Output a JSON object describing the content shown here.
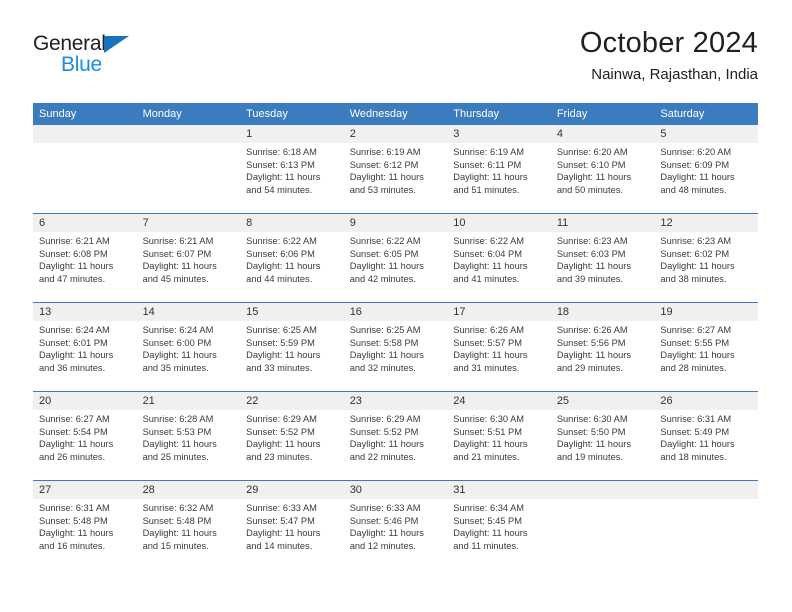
{
  "brand": {
    "name_top": "General",
    "name_bottom": "Blue",
    "accent_dark": "#1a72b8",
    "accent_light": "#1a8ede"
  },
  "header": {
    "title": "October 2024",
    "subtitle": "Nainwa, Rajasthan, India"
  },
  "theme": {
    "header_blue": "#3a7cbe",
    "number_band": "#f0f0f0",
    "text": "#3b3b3b"
  },
  "weekdays": [
    "Sunday",
    "Monday",
    "Tuesday",
    "Wednesday",
    "Thursday",
    "Friday",
    "Saturday"
  ],
  "labels": {
    "sunrise_prefix": "Sunrise:",
    "sunset_prefix": "Sunset:",
    "daylight_prefix": "Daylight:"
  },
  "weeks": [
    [
      {
        "day": "",
        "sunrise": "",
        "sunset": "",
        "daylight_line1": "",
        "daylight_line2": ""
      },
      {
        "day": "",
        "sunrise": "",
        "sunset": "",
        "daylight_line1": "",
        "daylight_line2": ""
      },
      {
        "day": "1",
        "sunrise": "Sunrise: 6:18 AM",
        "sunset": "Sunset: 6:13 PM",
        "daylight_line1": "Daylight: 11 hours",
        "daylight_line2": "and 54 minutes."
      },
      {
        "day": "2",
        "sunrise": "Sunrise: 6:19 AM",
        "sunset": "Sunset: 6:12 PM",
        "daylight_line1": "Daylight: 11 hours",
        "daylight_line2": "and 53 minutes."
      },
      {
        "day": "3",
        "sunrise": "Sunrise: 6:19 AM",
        "sunset": "Sunset: 6:11 PM",
        "daylight_line1": "Daylight: 11 hours",
        "daylight_line2": "and 51 minutes."
      },
      {
        "day": "4",
        "sunrise": "Sunrise: 6:20 AM",
        "sunset": "Sunset: 6:10 PM",
        "daylight_line1": "Daylight: 11 hours",
        "daylight_line2": "and 50 minutes."
      },
      {
        "day": "5",
        "sunrise": "Sunrise: 6:20 AM",
        "sunset": "Sunset: 6:09 PM",
        "daylight_line1": "Daylight: 11 hours",
        "daylight_line2": "and 48 minutes."
      }
    ],
    [
      {
        "day": "6",
        "sunrise": "Sunrise: 6:21 AM",
        "sunset": "Sunset: 6:08 PM",
        "daylight_line1": "Daylight: 11 hours",
        "daylight_line2": "and 47 minutes."
      },
      {
        "day": "7",
        "sunrise": "Sunrise: 6:21 AM",
        "sunset": "Sunset: 6:07 PM",
        "daylight_line1": "Daylight: 11 hours",
        "daylight_line2": "and 45 minutes."
      },
      {
        "day": "8",
        "sunrise": "Sunrise: 6:22 AM",
        "sunset": "Sunset: 6:06 PM",
        "daylight_line1": "Daylight: 11 hours",
        "daylight_line2": "and 44 minutes."
      },
      {
        "day": "9",
        "sunrise": "Sunrise: 6:22 AM",
        "sunset": "Sunset: 6:05 PM",
        "daylight_line1": "Daylight: 11 hours",
        "daylight_line2": "and 42 minutes."
      },
      {
        "day": "10",
        "sunrise": "Sunrise: 6:22 AM",
        "sunset": "Sunset: 6:04 PM",
        "daylight_line1": "Daylight: 11 hours",
        "daylight_line2": "and 41 minutes."
      },
      {
        "day": "11",
        "sunrise": "Sunrise: 6:23 AM",
        "sunset": "Sunset: 6:03 PM",
        "daylight_line1": "Daylight: 11 hours",
        "daylight_line2": "and 39 minutes."
      },
      {
        "day": "12",
        "sunrise": "Sunrise: 6:23 AM",
        "sunset": "Sunset: 6:02 PM",
        "daylight_line1": "Daylight: 11 hours",
        "daylight_line2": "and 38 minutes."
      }
    ],
    [
      {
        "day": "13",
        "sunrise": "Sunrise: 6:24 AM",
        "sunset": "Sunset: 6:01 PM",
        "daylight_line1": "Daylight: 11 hours",
        "daylight_line2": "and 36 minutes."
      },
      {
        "day": "14",
        "sunrise": "Sunrise: 6:24 AM",
        "sunset": "Sunset: 6:00 PM",
        "daylight_line1": "Daylight: 11 hours",
        "daylight_line2": "and 35 minutes."
      },
      {
        "day": "15",
        "sunrise": "Sunrise: 6:25 AM",
        "sunset": "Sunset: 5:59 PM",
        "daylight_line1": "Daylight: 11 hours",
        "daylight_line2": "and 33 minutes."
      },
      {
        "day": "16",
        "sunrise": "Sunrise: 6:25 AM",
        "sunset": "Sunset: 5:58 PM",
        "daylight_line1": "Daylight: 11 hours",
        "daylight_line2": "and 32 minutes."
      },
      {
        "day": "17",
        "sunrise": "Sunrise: 6:26 AM",
        "sunset": "Sunset: 5:57 PM",
        "daylight_line1": "Daylight: 11 hours",
        "daylight_line2": "and 31 minutes."
      },
      {
        "day": "18",
        "sunrise": "Sunrise: 6:26 AM",
        "sunset": "Sunset: 5:56 PM",
        "daylight_line1": "Daylight: 11 hours",
        "daylight_line2": "and 29 minutes."
      },
      {
        "day": "19",
        "sunrise": "Sunrise: 6:27 AM",
        "sunset": "Sunset: 5:55 PM",
        "daylight_line1": "Daylight: 11 hours",
        "daylight_line2": "and 28 minutes."
      }
    ],
    [
      {
        "day": "20",
        "sunrise": "Sunrise: 6:27 AM",
        "sunset": "Sunset: 5:54 PM",
        "daylight_line1": "Daylight: 11 hours",
        "daylight_line2": "and 26 minutes."
      },
      {
        "day": "21",
        "sunrise": "Sunrise: 6:28 AM",
        "sunset": "Sunset: 5:53 PM",
        "daylight_line1": "Daylight: 11 hours",
        "daylight_line2": "and 25 minutes."
      },
      {
        "day": "22",
        "sunrise": "Sunrise: 6:29 AM",
        "sunset": "Sunset: 5:52 PM",
        "daylight_line1": "Daylight: 11 hours",
        "daylight_line2": "and 23 minutes."
      },
      {
        "day": "23",
        "sunrise": "Sunrise: 6:29 AM",
        "sunset": "Sunset: 5:52 PM",
        "daylight_line1": "Daylight: 11 hours",
        "daylight_line2": "and 22 minutes."
      },
      {
        "day": "24",
        "sunrise": "Sunrise: 6:30 AM",
        "sunset": "Sunset: 5:51 PM",
        "daylight_line1": "Daylight: 11 hours",
        "daylight_line2": "and 21 minutes."
      },
      {
        "day": "25",
        "sunrise": "Sunrise: 6:30 AM",
        "sunset": "Sunset: 5:50 PM",
        "daylight_line1": "Daylight: 11 hours",
        "daylight_line2": "and 19 minutes."
      },
      {
        "day": "26",
        "sunrise": "Sunrise: 6:31 AM",
        "sunset": "Sunset: 5:49 PM",
        "daylight_line1": "Daylight: 11 hours",
        "daylight_line2": "and 18 minutes."
      }
    ],
    [
      {
        "day": "27",
        "sunrise": "Sunrise: 6:31 AM",
        "sunset": "Sunset: 5:48 PM",
        "daylight_line1": "Daylight: 11 hours",
        "daylight_line2": "and 16 minutes."
      },
      {
        "day": "28",
        "sunrise": "Sunrise: 6:32 AM",
        "sunset": "Sunset: 5:48 PM",
        "daylight_line1": "Daylight: 11 hours",
        "daylight_line2": "and 15 minutes."
      },
      {
        "day": "29",
        "sunrise": "Sunrise: 6:33 AM",
        "sunset": "Sunset: 5:47 PM",
        "daylight_line1": "Daylight: 11 hours",
        "daylight_line2": "and 14 minutes."
      },
      {
        "day": "30",
        "sunrise": "Sunrise: 6:33 AM",
        "sunset": "Sunset: 5:46 PM",
        "daylight_line1": "Daylight: 11 hours",
        "daylight_line2": "and 12 minutes."
      },
      {
        "day": "31",
        "sunrise": "Sunrise: 6:34 AM",
        "sunset": "Sunset: 5:45 PM",
        "daylight_line1": "Daylight: 11 hours",
        "daylight_line2": "and 11 minutes."
      },
      {
        "day": "",
        "sunrise": "",
        "sunset": "",
        "daylight_line1": "",
        "daylight_line2": ""
      },
      {
        "day": "",
        "sunrise": "",
        "sunset": "",
        "daylight_line1": "",
        "daylight_line2": ""
      }
    ]
  ]
}
